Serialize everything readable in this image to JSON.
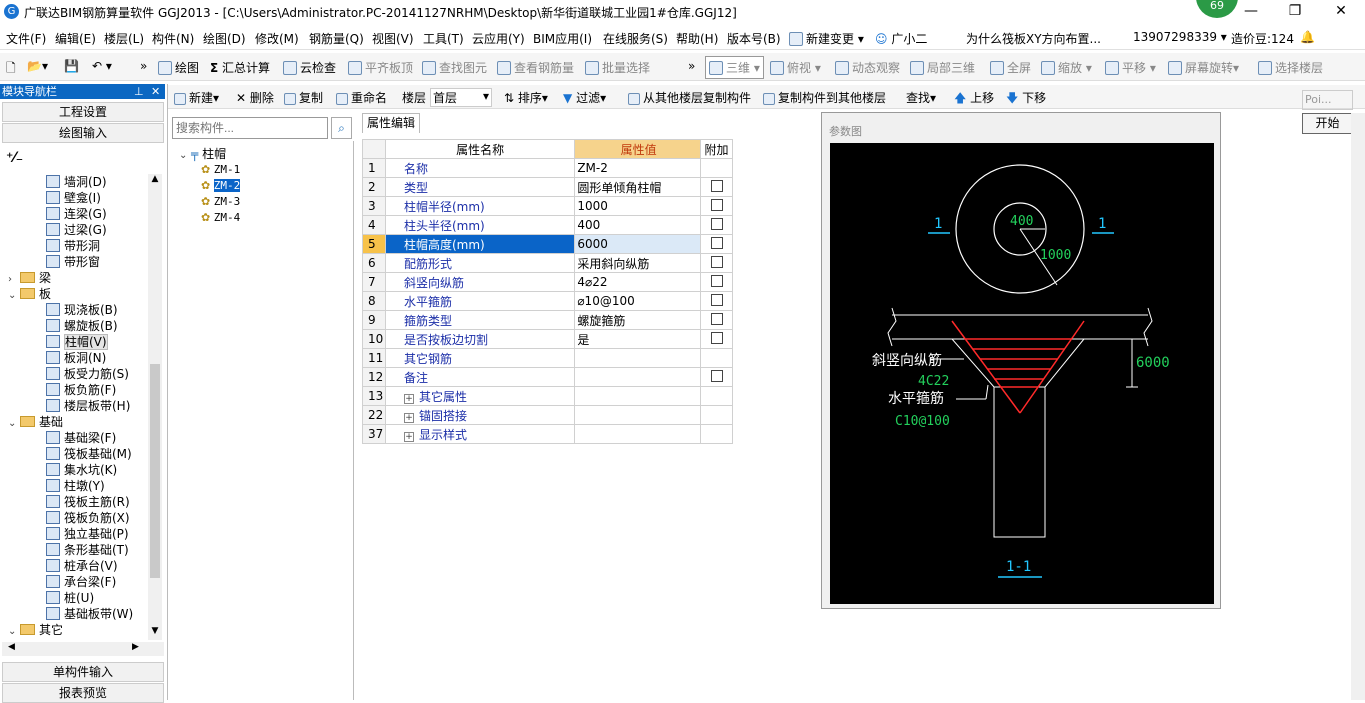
{
  "title": {
    "text": "广联达BIM钢筋算量软件 GGJ2013 - [C:\\Users\\Administrator.PC-20141127NRHM\\Desktop\\新华街道联城工业园1#仓库.GGJ12]",
    "badge": "69"
  },
  "menu": [
    "文件(F)",
    "编辑(E)",
    "楼层(L)",
    "构件(N)",
    "绘图(D)",
    "修改(M)",
    "钢筋量(Q)",
    "视图(V)",
    "工具(T)",
    "云应用(Y)",
    "BIM应用(I)",
    "在线服务(S)",
    "帮助(H)",
    "版本号(B)",
    "新建变更",
    "广小二",
    "为什么筏板XY方向布置...",
    "13907298339",
    "造价豆:124"
  ],
  "toolbar1": [
    "绘图",
    "汇总计算",
    "云检查",
    "平齐板顶",
    "查找图元",
    "查看钢筋量",
    "批量选择",
    "三维",
    "俯视",
    "动态观察",
    "局部三维",
    "全屏",
    "缩放",
    "平移",
    "屏幕旋转",
    "选择楼层"
  ],
  "toolbar2": [
    "新建",
    "删除",
    "复制",
    "重命名",
    "楼层",
    "首层",
    "排序",
    "过滤",
    "从其他楼层复制构件",
    "复制构件到其他楼层",
    "查找",
    "上移",
    "下移"
  ],
  "left": {
    "header": "模块导航栏",
    "btn_setup": "工程设置",
    "btn_draw": "绘图输入",
    "btn_single": "单构件输入",
    "btn_report": "报表预览",
    "tree": [
      {
        "label": "墙洞(D)",
        "type": "item"
      },
      {
        "label": "壁龛(I)",
        "type": "item"
      },
      {
        "label": "连梁(G)",
        "type": "item"
      },
      {
        "label": "过梁(G)",
        "type": "item"
      },
      {
        "label": "带形洞",
        "type": "item"
      },
      {
        "label": "带形窗",
        "type": "item"
      },
      {
        "label": "梁",
        "type": "folder",
        "open": false
      },
      {
        "label": "板",
        "type": "folder",
        "open": true
      },
      {
        "label": "现浇板(B)",
        "type": "item"
      },
      {
        "label": "螺旋板(B)",
        "type": "item"
      },
      {
        "label": "柱帽(V)",
        "type": "item",
        "selected": true
      },
      {
        "label": "板洞(N)",
        "type": "item"
      },
      {
        "label": "板受力筋(S)",
        "type": "item"
      },
      {
        "label": "板负筋(F)",
        "type": "item"
      },
      {
        "label": "楼层板带(H)",
        "type": "item"
      },
      {
        "label": "基础",
        "type": "folder",
        "open": true
      },
      {
        "label": "基础梁(F)",
        "type": "item"
      },
      {
        "label": "筏板基础(M)",
        "type": "item"
      },
      {
        "label": "集水坑(K)",
        "type": "item"
      },
      {
        "label": "柱墩(Y)",
        "type": "item"
      },
      {
        "label": "筏板主筋(R)",
        "type": "item"
      },
      {
        "label": "筏板负筋(X)",
        "type": "item"
      },
      {
        "label": "独立基础(P)",
        "type": "item"
      },
      {
        "label": "条形基础(T)",
        "type": "item"
      },
      {
        "label": "桩承台(V)",
        "type": "item"
      },
      {
        "label": "承台梁(F)",
        "type": "item"
      },
      {
        "label": "桩(U)",
        "type": "item"
      },
      {
        "label": "基础板带(W)",
        "type": "item"
      },
      {
        "label": "其它",
        "type": "folder",
        "open": true
      }
    ]
  },
  "components": {
    "search_placeholder": "搜索构件...",
    "root": "柱帽",
    "items": [
      "ZM-1",
      "ZM-2",
      "ZM-3",
      "ZM-4"
    ],
    "selected": "ZM-2"
  },
  "props": {
    "tab": "属性编辑",
    "headers": [
      "属性名称",
      "属性值",
      "附加"
    ],
    "rows": [
      {
        "n": "1",
        "name": "名称",
        "value": "ZM-2",
        "check": false
      },
      {
        "n": "2",
        "name": "类型",
        "value": "圆形单倾角柱帽",
        "check": true
      },
      {
        "n": "3",
        "name": "柱帽半径(mm)",
        "value": "1000",
        "check": true
      },
      {
        "n": "4",
        "name": "柱头半径(mm)",
        "value": "400",
        "check": true
      },
      {
        "n": "5",
        "name": "柱帽高度(mm)",
        "value": "6000",
        "check": true,
        "selected": true
      },
      {
        "n": "6",
        "name": "配筋形式",
        "value": "采用斜向纵筋",
        "check": true
      },
      {
        "n": "7",
        "name": "斜竖向纵筋",
        "value": "4⌀22",
        "check": true
      },
      {
        "n": "8",
        "name": "水平箍筋",
        "value": "⌀10@100",
        "check": true
      },
      {
        "n": "9",
        "name": "箍筋类型",
        "value": "螺旋箍筋",
        "check": true
      },
      {
        "n": "10",
        "name": "是否按板边切割",
        "value": "是",
        "check": true
      },
      {
        "n": "11",
        "name": "其它钢筋",
        "value": "",
        "check": false
      },
      {
        "n": "12",
        "name": "备注",
        "value": "",
        "check": true
      }
    ],
    "groups": [
      {
        "n": "13",
        "name": "其它属性"
      },
      {
        "n": "22",
        "name": "锚固搭接"
      },
      {
        "n": "37",
        "name": "显示样式"
      }
    ]
  },
  "param": {
    "title": "参数图",
    "outer_radius": "1000",
    "inner_radius": "400",
    "height": "6000",
    "label_left": "1",
    "label_right": "1",
    "label_section": "1-1",
    "label_rebar": "斜竖向纵筋",
    "label_rebar_value": "4C22",
    "label_stirrup": "水平箍筋",
    "label_stirrup_value": "C10@100"
  },
  "right": {
    "poi": "Poi...",
    "start": "开始"
  },
  "colors": {
    "accent": "#0b67c2",
    "selected_row": "#0a64c8",
    "header_value_bg": "#f6d38c",
    "cad_green": "#23d05c",
    "cad_cyan": "#22c7ff",
    "cad_red": "#ff2a2a"
  }
}
